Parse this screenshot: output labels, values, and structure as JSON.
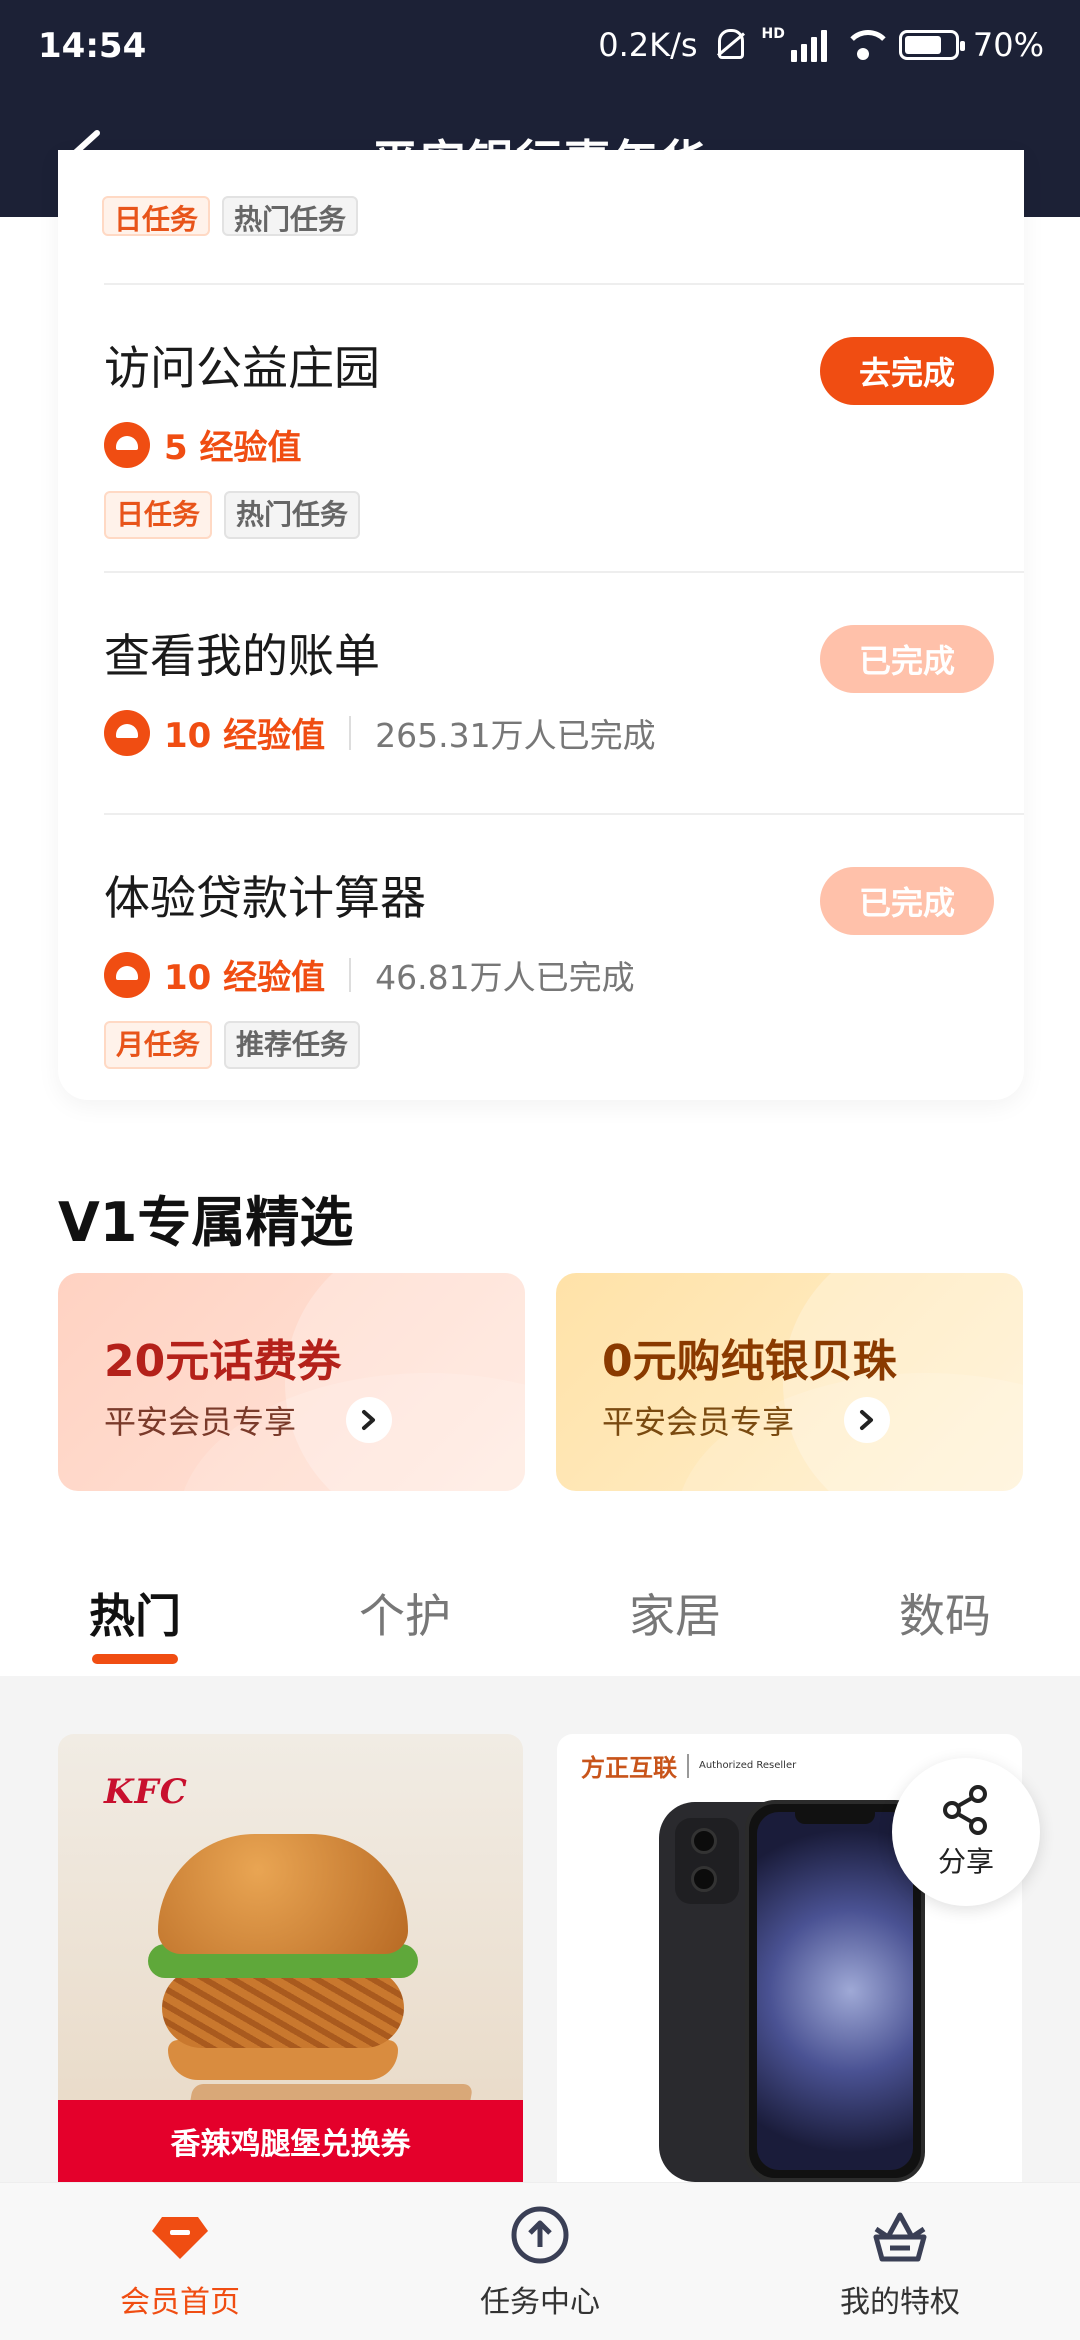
{
  "status_bar": {
    "time": "14:54",
    "network_speed": "0.2K/s",
    "hd_label": "HD",
    "battery": "70%"
  },
  "header": {
    "title": "平安银行嘉年华"
  },
  "partial_tags": [
    "日任务",
    "热门任务"
  ],
  "tasks": [
    {
      "name": "访问公益庄园",
      "exp": "5 经验值",
      "tags": [
        "日任务",
        "热门任务"
      ],
      "button": "去完成"
    },
    {
      "name": "查看我的账单",
      "exp": "10 经验值",
      "completed_count": "265.31万人已完成",
      "button": "已完成"
    },
    {
      "name": "体验贷款计算器",
      "exp": "10 经验值",
      "completed_count": "46.81万人已完成",
      "tags": [
        "月任务",
        "推荐任务"
      ],
      "button": "已完成"
    }
  ],
  "section": {
    "title": "V1专属精选"
  },
  "promos": [
    {
      "title": "20元话费券",
      "subtitle": "平安会员专享"
    },
    {
      "title": "0元购纯银贝珠",
      "subtitle": "平安会员专享"
    }
  ],
  "tabs": [
    "热门",
    "个护",
    "家居",
    "数码"
  ],
  "products": {
    "kfc": {
      "logo": "KFC",
      "banner": "香辣鸡腿堡兑换券"
    },
    "phone": {
      "brand": "方正互联",
      "reseller": "Authorized Reseller"
    }
  },
  "share": {
    "label": "分享"
  },
  "bottom_nav": [
    {
      "label": "会员首页",
      "icon": "gem-icon",
      "active": true
    },
    {
      "label": "任务中心",
      "icon": "upload-circle-icon",
      "active": false
    },
    {
      "label": "我的特权",
      "icon": "crown-basket-icon",
      "active": false
    }
  ],
  "colors": {
    "accent": "#f04d12",
    "header_bg": "#1c2136",
    "done_button": "#ffc1aa"
  }
}
